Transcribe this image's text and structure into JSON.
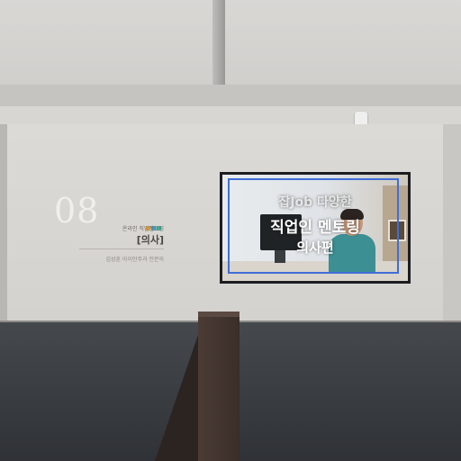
{
  "exhibit": {
    "number": "08",
    "subtitle": "온라인 직업멘토링",
    "title": "[의사]",
    "name": "김성훈 아이안주과 전문의",
    "accent_colors": [
      "#f0a63a",
      "#4aa3c8",
      "#3ab59b"
    ]
  },
  "video": {
    "line1": "잡Job 다양한",
    "line2": "직업인 멘토링",
    "line3": "의사편",
    "frame_color": "#3f6ed8"
  }
}
